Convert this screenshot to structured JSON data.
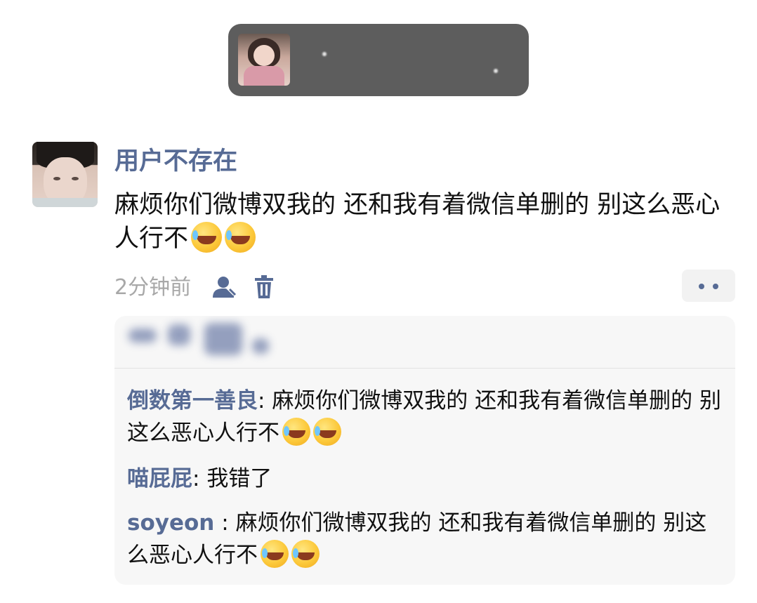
{
  "top_banner": {
    "thumbnail_icon": "profile-photo-thumbnail"
  },
  "comment": {
    "username": "用户不存在",
    "text": "麻烦你们微博双我的 还和我有着微信单删的 别这么恶心人行不",
    "emoji_count": 2,
    "timestamp": "2分钟前"
  },
  "replies": [
    {
      "name": "倒数第一善良",
      "sep": ": ",
      "text": "麻烦你们微博双我的 还和我有着微信单删的 别这么恶心人行不"
    },
    {
      "name": "喵屁屁",
      "sep": ": ",
      "text": "我错了"
    },
    {
      "name": "soyeon",
      "sep": " : ",
      "text": "麻烦你们微博双我的 还和我有着微信单删的 别这么恶心人行不"
    }
  ],
  "colors": {
    "link": "#576b95",
    "text": "#111111",
    "muted": "#a8a8a8",
    "reply_bg": "#f7f7f7",
    "banner_bg": "#5d5d5d"
  }
}
